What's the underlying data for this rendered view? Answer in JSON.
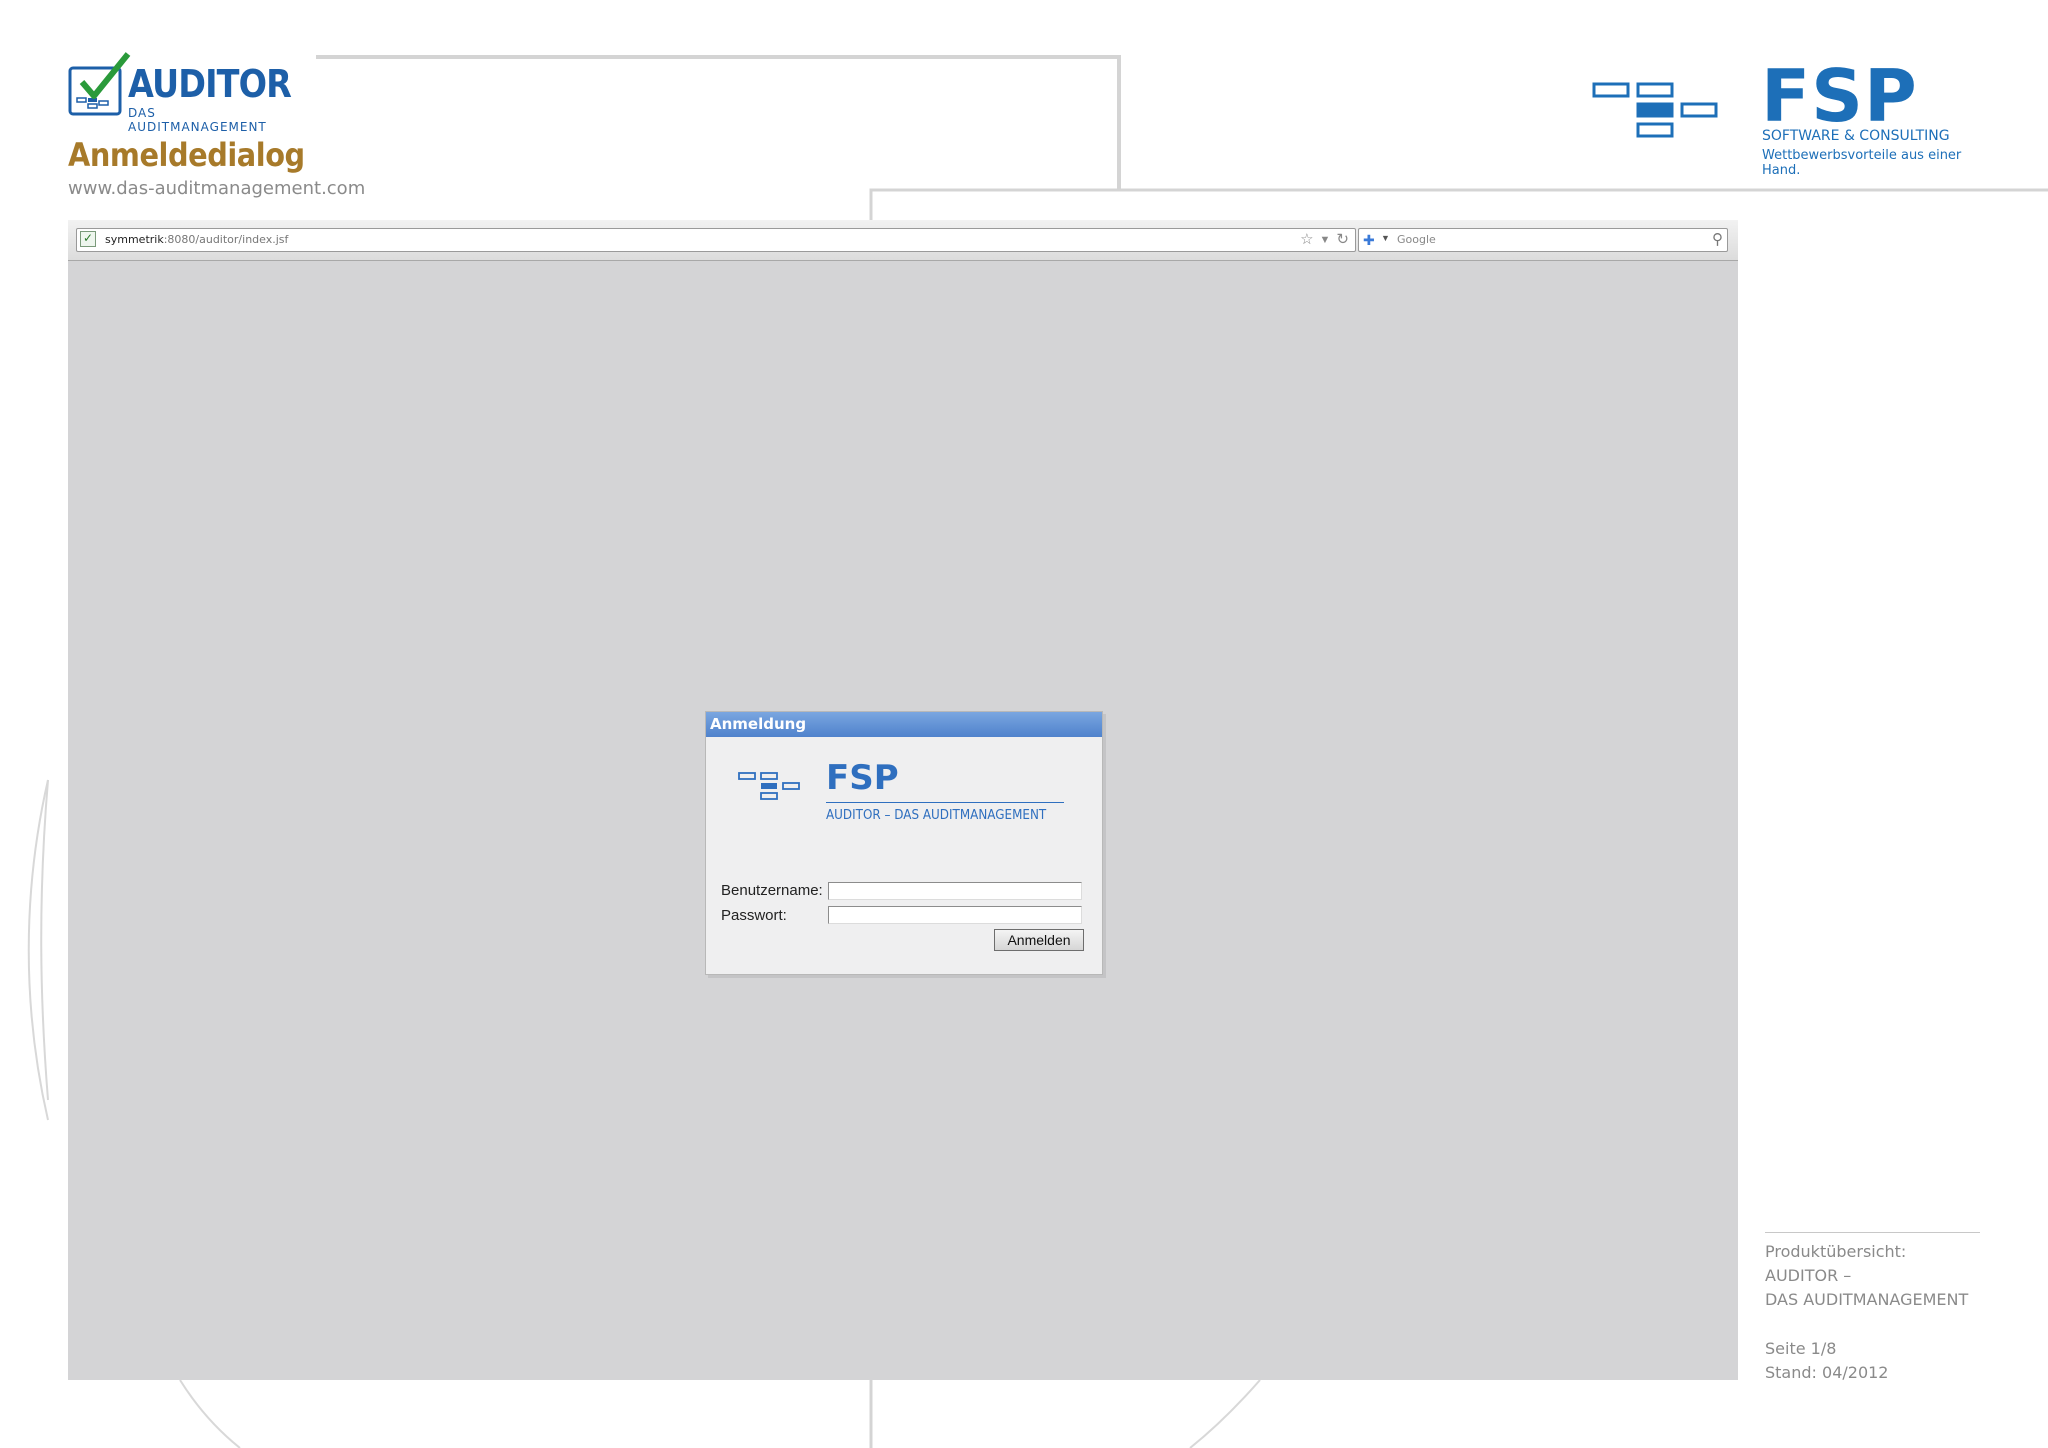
{
  "header": {
    "logo_title": "AUDITOR",
    "logo_subtitle": "DAS AUDITMANAGEMENT",
    "page_title": "Anmeldedialog",
    "page_url": "www.das-auditmanagement.com"
  },
  "brand": {
    "name": "FSP",
    "tagline": "SOFTWARE & CONSULTING",
    "slogan": "Wettbewerbsvorteile aus einer Hand.",
    "color": "#1d6fb8"
  },
  "browser": {
    "url_host": "symmetrik",
    "url_path": ":8080/auditor/index.jsf",
    "search_placeholder": "Google",
    "icons": {
      "site": "check-document-icon",
      "bookmark": "star-icon",
      "history": "dropdown-arrow-icon",
      "reload": "reload-icon",
      "search_engine": "google-icon",
      "search": "magnifier-icon"
    }
  },
  "dialog": {
    "title": "Anmeldung",
    "logo_name": "FSP",
    "logo_subtitle": "AUDITOR – DAS AUDITMANAGEMENT",
    "username_label": "Benutzername:",
    "username_value": "",
    "password_label": "Passwort:",
    "password_value": "",
    "submit_label": "Anmelden",
    "header_color": "#5a8bd0"
  },
  "footer": {
    "overview_label": "Produktübersicht:",
    "product_line1": "AUDITOR –",
    "product_line2": "DAS AUDITMANAGEMENT",
    "page": "Seite 1/8",
    "date": "Stand: 04/2012"
  }
}
